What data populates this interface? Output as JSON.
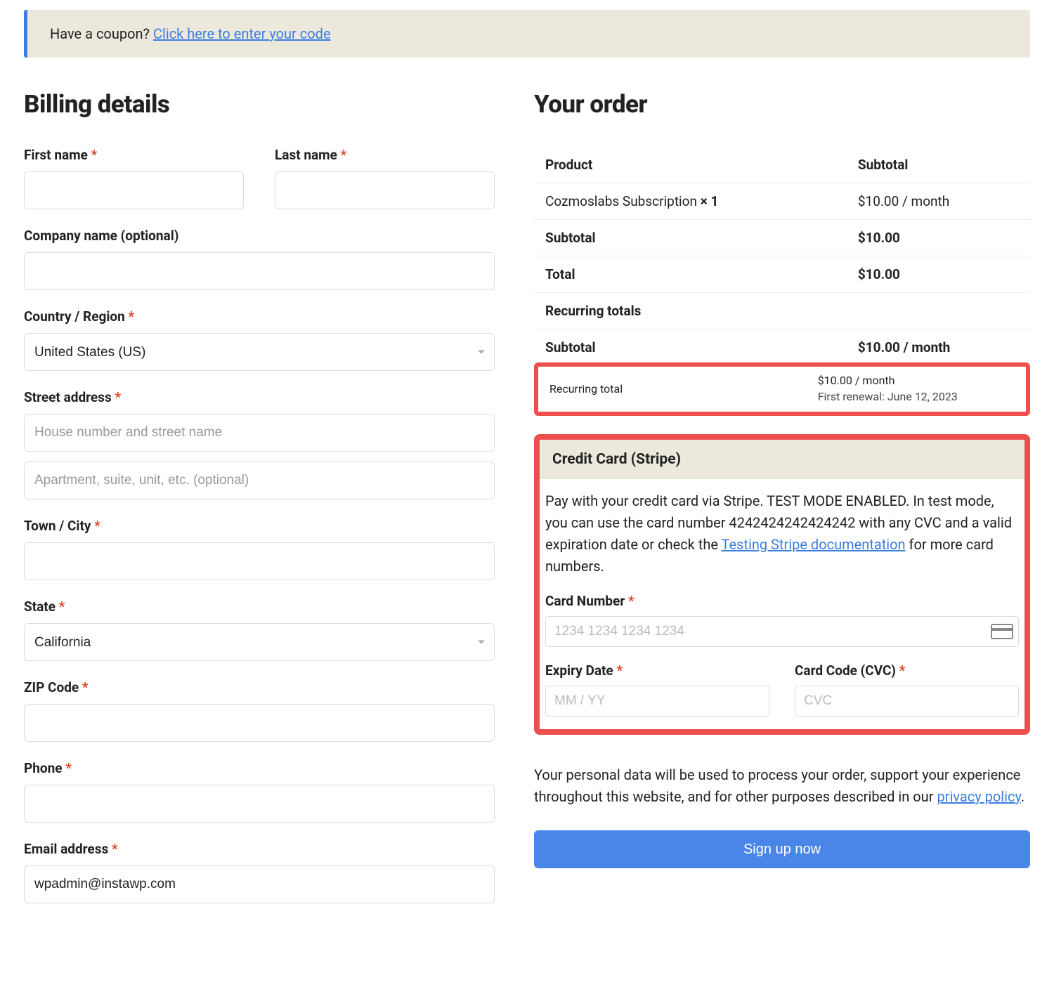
{
  "coupon": {
    "prompt": "Have a coupon? ",
    "link_text": "Click here to enter your code"
  },
  "billing": {
    "title": "Billing details",
    "first_name_label": "First name",
    "last_name_label": "Last name",
    "company_label": "Company name (optional)",
    "country_label": "Country / Region",
    "country_value": "United States (US)",
    "street_label": "Street address",
    "street_placeholder1": "House number and street name",
    "street_placeholder2": "Apartment, suite, unit, etc. (optional)",
    "city_label": "Town / City",
    "state_label": "State",
    "state_value": "California",
    "zip_label": "ZIP Code",
    "phone_label": "Phone",
    "email_label": "Email address",
    "email_value": "wpadmin@instawp.com"
  },
  "order": {
    "title": "Your order",
    "col_product": "Product",
    "col_subtotal": "Subtotal",
    "product_name": "Cozmoslabs Subscription ",
    "product_qty": " × 1",
    "product_price": "$10.00 / month",
    "subtotal_label": "Subtotal",
    "subtotal_value": "$10.00",
    "total_label": "Total",
    "total_value": "$10.00",
    "recurring_header": "Recurring totals",
    "recurring_subtotal_label": "Subtotal",
    "recurring_subtotal_value": "$10.00 / month",
    "recurring_total_label": "Recurring total",
    "recurring_total_value": "$10.00 / month",
    "first_renewal": "First renewal: June 12, 2023"
  },
  "payment": {
    "header": "Credit Card (Stripe)",
    "desc_part1": "Pay with your credit card via Stripe. TEST MODE ENABLED. In test mode, you can use the card number 4242424242424242 with any CVC and a valid expiration date or check the ",
    "desc_link": "Testing Stripe documentation",
    "desc_part2": " for more card numbers.",
    "card_number_label": "Card Number",
    "card_number_placeholder": "1234 1234 1234 1234",
    "expiry_label": "Expiry Date",
    "expiry_placeholder": "MM / YY",
    "cvc_label": "Card Code (CVC)",
    "cvc_placeholder": "CVC"
  },
  "privacy": {
    "text_part1": "Your personal data will be used to process your order, support your experience throughout this website, and for other purposes described in our ",
    "link_text": "privacy policy",
    "text_part2": "."
  },
  "signup_button": "Sign up now"
}
